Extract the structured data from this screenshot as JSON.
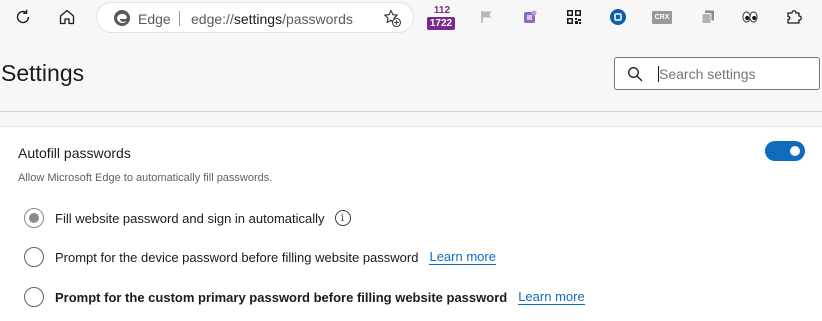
{
  "toolbar": {
    "omnibox": {
      "brand": "Edge",
      "url_prefix": "edge://",
      "url_host": "settings",
      "url_path": "/passwords"
    },
    "extensions": [
      {
        "name": "counter-extension",
        "top": "112",
        "bottom": "1722"
      },
      {
        "name": "flag-icon"
      },
      {
        "name": "puzzle-extension-icon"
      },
      {
        "name": "qr-code-icon"
      },
      {
        "name": "circle-extension-icon"
      },
      {
        "name": "crx-extension",
        "label": "CRX"
      },
      {
        "name": "copy-extension-icon"
      },
      {
        "name": "eyes-extension-icon"
      },
      {
        "name": "extensions-icon"
      }
    ]
  },
  "header": {
    "title": "Settings"
  },
  "search": {
    "placeholder": "Search settings"
  },
  "autofill": {
    "title": "Autofill passwords",
    "description": "Allow Microsoft Edge to automatically fill passwords.",
    "enabled": true,
    "options": [
      {
        "label": "Fill website password and sign in automatically",
        "selected": true,
        "info": "i"
      },
      {
        "label": "Prompt for the device password before filling website password",
        "selected": false,
        "link": "Learn more"
      },
      {
        "label": "Prompt for the custom primary password before filling website password",
        "selected": false,
        "link": "Learn more"
      }
    ]
  },
  "colors": {
    "accent": "#0f6cbd",
    "counter": "#7a2a8a"
  }
}
